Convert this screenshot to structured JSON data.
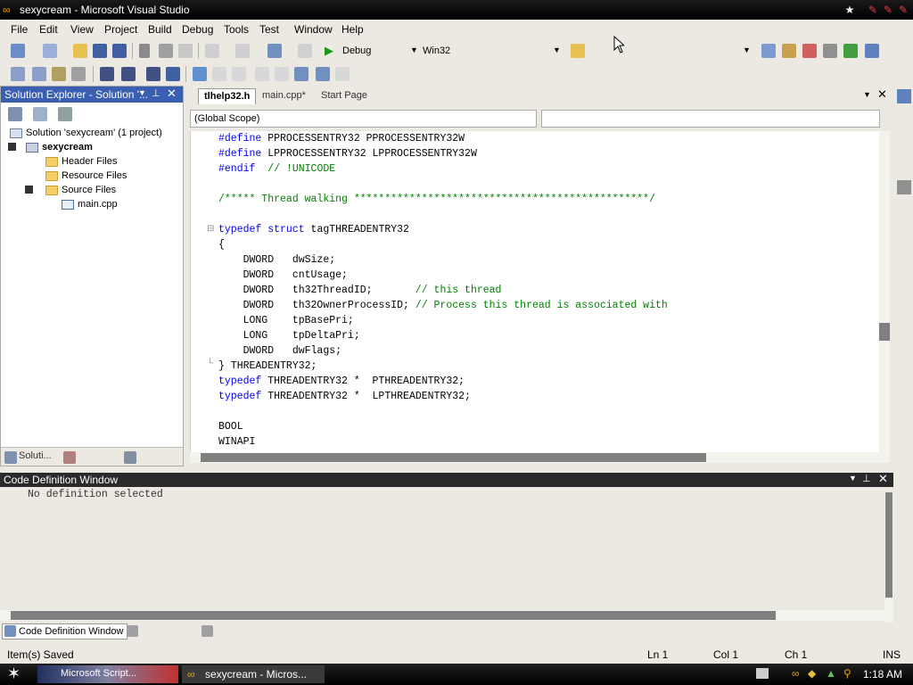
{
  "window": {
    "title": "sexycream - Microsoft Visual Studio"
  },
  "menu": [
    "File",
    "Edit",
    "View",
    "Project",
    "Build",
    "Debug",
    "Tools",
    "Test",
    "Window",
    "Help"
  ],
  "toolbar": {
    "config": "Debug",
    "platform": "Win32"
  },
  "solution_explorer": {
    "title": "Solution Explorer - Solution '...",
    "items": [
      {
        "label": "Solution 'sexycream' (1 project)"
      },
      {
        "label": "sexycream"
      },
      {
        "label": "Header Files"
      },
      {
        "label": "Resource Files"
      },
      {
        "label": "Source Files"
      },
      {
        "label": "main.cpp"
      }
    ],
    "bottom_tab": "Soluti..."
  },
  "editor": {
    "tabs": [
      {
        "label": "tlhelp32.h"
      },
      {
        "label": "main.cpp*"
      },
      {
        "label": "Start Page"
      }
    ],
    "scope": "(Global Scope)",
    "lines": [
      [
        {
          "t": "#define",
          "c": "kw"
        },
        {
          "t": " PPROCESSENTRY32 PPROCESSENTRY32W"
        }
      ],
      [
        {
          "t": "#define",
          "c": "kw"
        },
        {
          "t": " LPPROCESSENTRY32 LPPROCESSENTRY32W"
        }
      ],
      [
        {
          "t": "#endif",
          "c": "kw"
        },
        {
          "t": "  "
        },
        {
          "t": "// !UNICODE",
          "c": "cm"
        }
      ],
      [],
      [
        {
          "t": "/***** Thread walking ************************************************/",
          "c": "cm"
        }
      ],
      [],
      [
        {
          "t": "typedef",
          "c": "kw"
        },
        {
          "t": " "
        },
        {
          "t": "struct",
          "c": "kw"
        },
        {
          "t": " tagTHREADENTRY32"
        }
      ],
      [
        {
          "t": "{"
        }
      ],
      [
        {
          "t": "    DWORD   dwSize;"
        }
      ],
      [
        {
          "t": "    DWORD   cntUsage;"
        }
      ],
      [
        {
          "t": "    DWORD   th32ThreadID;       "
        },
        {
          "t": "// this thread",
          "c": "cm"
        }
      ],
      [
        {
          "t": "    DWORD   th32OwnerProcessID; "
        },
        {
          "t": "// Process this thread is associated with",
          "c": "cm"
        }
      ],
      [
        {
          "t": "    LONG    tpBasePri;"
        }
      ],
      [
        {
          "t": "    LONG    tpDeltaPri;"
        }
      ],
      [
        {
          "t": "    DWORD   dwFlags;"
        }
      ],
      [
        {
          "t": "} THREADENTRY32;"
        }
      ],
      [
        {
          "t": "typedef",
          "c": "kw"
        },
        {
          "t": " THREADENTRY32 *  PTHREADENTRY32;"
        }
      ],
      [
        {
          "t": "typedef",
          "c": "kw"
        },
        {
          "t": " THREADENTRY32 *  LPTHREADENTRY32;"
        }
      ],
      [],
      [
        {
          "t": "BOOL"
        }
      ],
      [
        {
          "t": "WINAPI"
        }
      ]
    ]
  },
  "code_definition": {
    "title": "Code Definition Window",
    "body": "No definition selected",
    "bottom_tab": "Code Definition Window"
  },
  "status": {
    "left": "Item(s) Saved",
    "ln": "Ln 1",
    "col": "Col 1",
    "ch": "Ch 1",
    "mode": "INS"
  },
  "taskbar": {
    "task1": "Microsoft Script...",
    "task2": "sexycream - Micros...",
    "clock": "1:18 AM"
  },
  "colors": {
    "keyword": "#0000ff",
    "comment": "#008000",
    "panel_header": "#3b5fb0"
  }
}
